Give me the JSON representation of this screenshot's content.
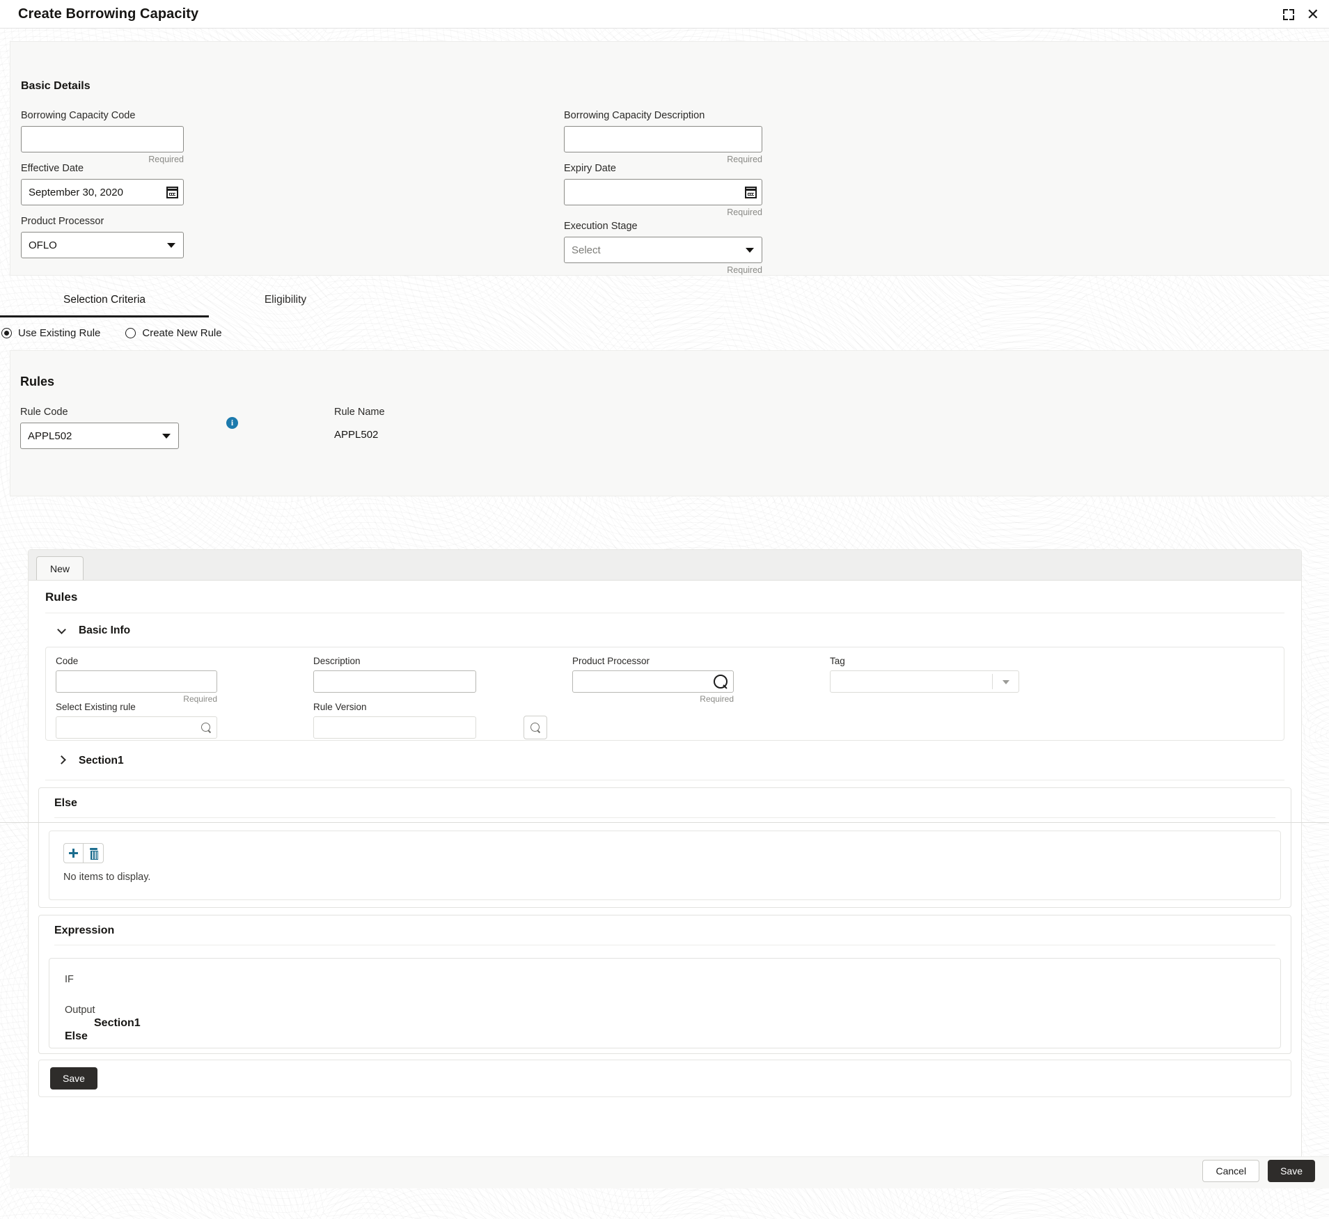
{
  "window": {
    "title": "Create Borrowing Capacity",
    "collapse_icon": "collapse-icon",
    "close_icon": "close-icon",
    "close_glyph": "✕"
  },
  "basic_details": {
    "section_title": "Basic Details",
    "fields": {
      "borrowing_capacity_code": {
        "label": "Borrowing Capacity Code",
        "value": "",
        "placeholder": "",
        "helper": "Required"
      },
      "borrowing_capacity_description": {
        "label": "Borrowing Capacity Description",
        "value": "",
        "placeholder": "",
        "helper": "Required"
      },
      "effective_date": {
        "label": "Effective Date",
        "value": "September 30, 2020",
        "icon": "calendar-icon",
        "helper": ""
      },
      "expiry_date": {
        "label": "Expiry Date",
        "value": "",
        "placeholder": "",
        "icon": "calendar-icon",
        "helper": "Required"
      },
      "product_processor": {
        "label": "Product Processor",
        "value": "OFLO",
        "options": [
          "OFLO"
        ],
        "helper": ""
      },
      "execution_stage": {
        "label": "Execution Stage",
        "value": "",
        "placeholder": "Select",
        "options": [
          "Select"
        ],
        "helper": "Required"
      }
    }
  },
  "tabs": [
    {
      "label": "Selection Criteria",
      "active": true
    },
    {
      "label": "Eligibility",
      "active": false
    }
  ],
  "rule_mode_radios": [
    {
      "label": "Use Existing Rule",
      "checked": true
    },
    {
      "label": "Create New Rule",
      "checked": false
    }
  ],
  "rules_card": {
    "section_title": "Rules",
    "rule_code": {
      "label": "Rule Code",
      "value": "APPL502",
      "options": [
        "APPL502"
      ],
      "info_icon": "info-icon",
      "info_glyph": "i"
    },
    "rule_name": {
      "label": "Rule Name",
      "value": "APPL502"
    }
  },
  "inner_panel": {
    "tab_new": "New",
    "heading": "Rules",
    "basic_info": {
      "label": "Basic Info",
      "expanded": true,
      "fields": {
        "code": {
          "label": "Code",
          "value": "",
          "helper": "Required"
        },
        "description": {
          "label": "Description",
          "value": "",
          "helper": ""
        },
        "product_processor": {
          "label": "Product Processor",
          "value": "",
          "helper": "Required",
          "icon": "search-icon"
        },
        "tag": {
          "label": "Tag",
          "value": "",
          "helper": "",
          "options": []
        },
        "select_existing_rule": {
          "label": "Select Existing rule",
          "value": "",
          "helper": "",
          "icon": "search-icon"
        },
        "rule_version": {
          "label": "Rule Version",
          "value": "",
          "helper": ""
        }
      },
      "search_button": {
        "name": "rule-version-search-button",
        "icon": "search-icon"
      }
    },
    "section1": {
      "label": "Section1",
      "expanded": false
    },
    "else_block": {
      "heading": "Else",
      "add_button": {
        "label": "",
        "icon": "plus-icon"
      },
      "delete_button": {
        "label": "",
        "icon": "trash-icon"
      },
      "empty_message": "No items to display."
    },
    "expression_block": {
      "heading": "Expression",
      "lines": {
        "if": "IF",
        "output": "Output",
        "section": "Section1",
        "else": "Else"
      }
    },
    "save_label": "Save"
  },
  "footer": {
    "cancel_label": "Cancel",
    "save_label": "Save"
  },
  "colors": {
    "accent_info": "#1c7aad",
    "accent_icon": "#1c6d8e",
    "button_dark": "#2e2c2a",
    "card_bg": "#f8f8f7",
    "page_bg": "#ffffff"
  }
}
